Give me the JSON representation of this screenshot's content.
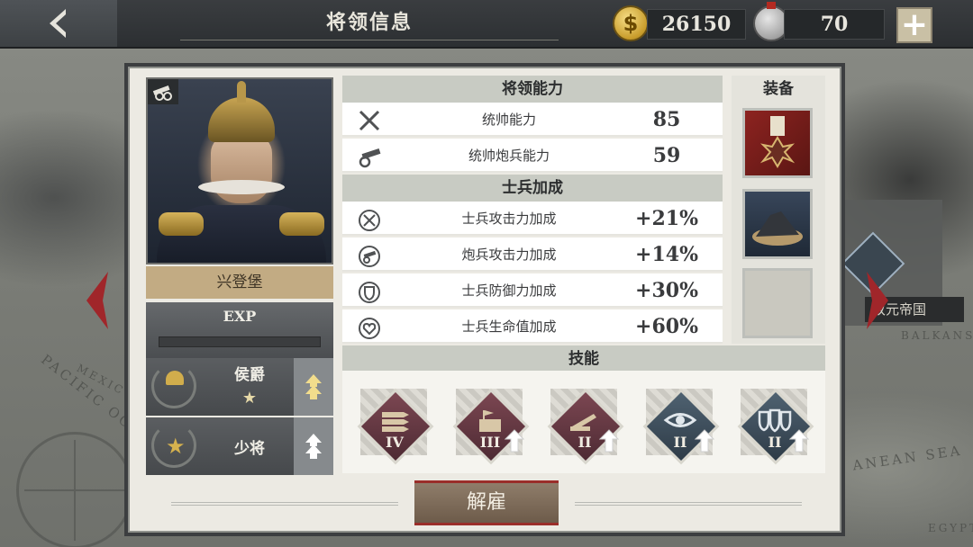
{
  "header": {
    "title": "将领信息",
    "gold": "26150",
    "medals": "70",
    "plus_label": "+"
  },
  "general": {
    "name": "兴登堡",
    "exp_label": "EXP",
    "exp_progress": 0,
    "rank_title": "侯爵",
    "rank_stars": "★",
    "military_rank": "少将"
  },
  "sections": {
    "ability": "将领能力",
    "bonus": "士兵加成",
    "equipment": "装备",
    "skills": "技能"
  },
  "abilities": [
    {
      "icon": "crossed-swords-icon",
      "label": "统帅能力",
      "value": "85"
    },
    {
      "icon": "cannon-icon",
      "label": "统帅炮兵能力",
      "value": "59"
    }
  ],
  "bonuses": [
    {
      "icon": "attack-up-icon",
      "label": "士兵攻击力加成",
      "value": "+21%"
    },
    {
      "icon": "artillery-up-icon",
      "label": "炮兵攻击力加成",
      "value": "+14%"
    },
    {
      "icon": "shield-up-icon",
      "label": "士兵防御力加成",
      "value": "+30%"
    },
    {
      "icon": "heart-up-icon",
      "label": "士兵生命值加成",
      "value": "+60%"
    }
  ],
  "equipment": [
    {
      "icon": "iron-cross-medal-icon"
    },
    {
      "icon": "mineral-pile-icon"
    },
    {
      "icon": "empty-slot"
    }
  ],
  "skills": [
    {
      "icon": "rockets-icon",
      "level": "IV",
      "upgradable": false,
      "color": "red"
    },
    {
      "icon": "fortress-icon",
      "level": "III",
      "upgradable": true,
      "color": "red"
    },
    {
      "icon": "artillery-icon",
      "level": "II",
      "upgradable": true,
      "color": "red"
    },
    {
      "icon": "eye-icon",
      "level": "II",
      "upgradable": true,
      "color": "blue"
    },
    {
      "icon": "triple-shield-icon",
      "level": "II",
      "upgradable": true,
      "color": "blue"
    }
  ],
  "dismiss_label": "解雇",
  "map": {
    "labels": [
      "PACIFIC OCEAN",
      "MEXICO",
      "ANEAN SEA",
      "BALKANS",
      "EGYPT"
    ],
    "peek_label": "双元帝国"
  },
  "colors": {
    "accent_gold": "#c2ab83",
    "dismiss_border": "#9a2e2a",
    "red_arrow": "#a0262a"
  }
}
